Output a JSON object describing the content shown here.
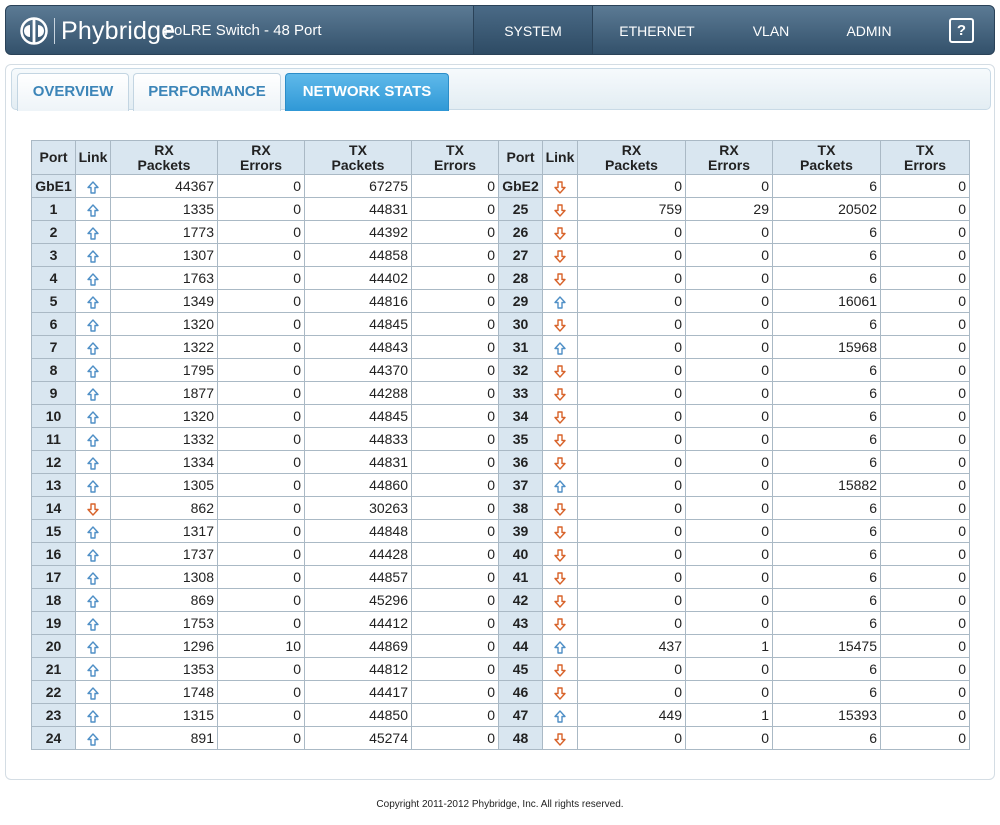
{
  "header": {
    "brand": "Phybridge",
    "product": "PoLRE Switch - 48 Port",
    "nav": [
      {
        "label": "SYSTEM",
        "active": true
      },
      {
        "label": "ETHERNET",
        "active": false
      },
      {
        "label": "VLAN",
        "active": false
      },
      {
        "label": "ADMIN",
        "active": false
      }
    ],
    "help_label": "?"
  },
  "tabs": [
    {
      "label": "OVERVIEW",
      "active": false
    },
    {
      "label": "PERFORMANCE",
      "active": false
    },
    {
      "label": "NETWORK STATS",
      "active": true
    }
  ],
  "colors": {
    "link_up": "#4f8fc6",
    "link_down": "#d8632a",
    "header_cell": "#d9e6f0",
    "active_tab": "#3aa3de"
  },
  "table": {
    "headers": [
      [
        "Port"
      ],
      [
        "Link"
      ],
      [
        "RX",
        "Packets"
      ],
      [
        "RX",
        "Errors"
      ],
      [
        "TX",
        "Packets"
      ],
      [
        "TX",
        "Errors"
      ],
      [
        "Port"
      ],
      [
        "Link"
      ],
      [
        "RX",
        "Packets"
      ],
      [
        "RX",
        "Errors"
      ],
      [
        "TX",
        "Packets"
      ],
      [
        "TX",
        "Errors"
      ]
    ],
    "rows": [
      {
        "left": {
          "port": "GbE1",
          "link": "up",
          "rx_packets": "44367",
          "rx_errors": "0",
          "tx_packets": "67275",
          "tx_errors": "0"
        },
        "right": {
          "port": "GbE2",
          "link": "down",
          "rx_packets": "0",
          "rx_errors": "0",
          "tx_packets": "6",
          "tx_errors": "0"
        }
      },
      {
        "left": {
          "port": "1",
          "link": "up",
          "rx_packets": "1335",
          "rx_errors": "0",
          "tx_packets": "44831",
          "tx_errors": "0"
        },
        "right": {
          "port": "25",
          "link": "down",
          "rx_packets": "759",
          "rx_errors": "29",
          "tx_packets": "20502",
          "tx_errors": "0"
        }
      },
      {
        "left": {
          "port": "2",
          "link": "up",
          "rx_packets": "1773",
          "rx_errors": "0",
          "tx_packets": "44392",
          "tx_errors": "0"
        },
        "right": {
          "port": "26",
          "link": "down",
          "rx_packets": "0",
          "rx_errors": "0",
          "tx_packets": "6",
          "tx_errors": "0"
        }
      },
      {
        "left": {
          "port": "3",
          "link": "up",
          "rx_packets": "1307",
          "rx_errors": "0",
          "tx_packets": "44858",
          "tx_errors": "0"
        },
        "right": {
          "port": "27",
          "link": "down",
          "rx_packets": "0",
          "rx_errors": "0",
          "tx_packets": "6",
          "tx_errors": "0"
        }
      },
      {
        "left": {
          "port": "4",
          "link": "up",
          "rx_packets": "1763",
          "rx_errors": "0",
          "tx_packets": "44402",
          "tx_errors": "0"
        },
        "right": {
          "port": "28",
          "link": "down",
          "rx_packets": "0",
          "rx_errors": "0",
          "tx_packets": "6",
          "tx_errors": "0"
        }
      },
      {
        "left": {
          "port": "5",
          "link": "up",
          "rx_packets": "1349",
          "rx_errors": "0",
          "tx_packets": "44816",
          "tx_errors": "0"
        },
        "right": {
          "port": "29",
          "link": "up",
          "rx_packets": "0",
          "rx_errors": "0",
          "tx_packets": "16061",
          "tx_errors": "0"
        }
      },
      {
        "left": {
          "port": "6",
          "link": "up",
          "rx_packets": "1320",
          "rx_errors": "0",
          "tx_packets": "44845",
          "tx_errors": "0"
        },
        "right": {
          "port": "30",
          "link": "down",
          "rx_packets": "0",
          "rx_errors": "0",
          "tx_packets": "6",
          "tx_errors": "0"
        }
      },
      {
        "left": {
          "port": "7",
          "link": "up",
          "rx_packets": "1322",
          "rx_errors": "0",
          "tx_packets": "44843",
          "tx_errors": "0"
        },
        "right": {
          "port": "31",
          "link": "up",
          "rx_packets": "0",
          "rx_errors": "0",
          "tx_packets": "15968",
          "tx_errors": "0"
        }
      },
      {
        "left": {
          "port": "8",
          "link": "up",
          "rx_packets": "1795",
          "rx_errors": "0",
          "tx_packets": "44370",
          "tx_errors": "0"
        },
        "right": {
          "port": "32",
          "link": "down",
          "rx_packets": "0",
          "rx_errors": "0",
          "tx_packets": "6",
          "tx_errors": "0"
        }
      },
      {
        "left": {
          "port": "9",
          "link": "up",
          "rx_packets": "1877",
          "rx_errors": "0",
          "tx_packets": "44288",
          "tx_errors": "0"
        },
        "right": {
          "port": "33",
          "link": "down",
          "rx_packets": "0",
          "rx_errors": "0",
          "tx_packets": "6",
          "tx_errors": "0"
        }
      },
      {
        "left": {
          "port": "10",
          "link": "up",
          "rx_packets": "1320",
          "rx_errors": "0",
          "tx_packets": "44845",
          "tx_errors": "0"
        },
        "right": {
          "port": "34",
          "link": "down",
          "rx_packets": "0",
          "rx_errors": "0",
          "tx_packets": "6",
          "tx_errors": "0"
        }
      },
      {
        "left": {
          "port": "11",
          "link": "up",
          "rx_packets": "1332",
          "rx_errors": "0",
          "tx_packets": "44833",
          "tx_errors": "0"
        },
        "right": {
          "port": "35",
          "link": "down",
          "rx_packets": "0",
          "rx_errors": "0",
          "tx_packets": "6",
          "tx_errors": "0"
        }
      },
      {
        "left": {
          "port": "12",
          "link": "up",
          "rx_packets": "1334",
          "rx_errors": "0",
          "tx_packets": "44831",
          "tx_errors": "0"
        },
        "right": {
          "port": "36",
          "link": "down",
          "rx_packets": "0",
          "rx_errors": "0",
          "tx_packets": "6",
          "tx_errors": "0"
        }
      },
      {
        "left": {
          "port": "13",
          "link": "up",
          "rx_packets": "1305",
          "rx_errors": "0",
          "tx_packets": "44860",
          "tx_errors": "0"
        },
        "right": {
          "port": "37",
          "link": "up",
          "rx_packets": "0",
          "rx_errors": "0",
          "tx_packets": "15882",
          "tx_errors": "0"
        }
      },
      {
        "left": {
          "port": "14",
          "link": "down",
          "rx_packets": "862",
          "rx_errors": "0",
          "tx_packets": "30263",
          "tx_errors": "0"
        },
        "right": {
          "port": "38",
          "link": "down",
          "rx_packets": "0",
          "rx_errors": "0",
          "tx_packets": "6",
          "tx_errors": "0"
        }
      },
      {
        "left": {
          "port": "15",
          "link": "up",
          "rx_packets": "1317",
          "rx_errors": "0",
          "tx_packets": "44848",
          "tx_errors": "0"
        },
        "right": {
          "port": "39",
          "link": "down",
          "rx_packets": "0",
          "rx_errors": "0",
          "tx_packets": "6",
          "tx_errors": "0"
        }
      },
      {
        "left": {
          "port": "16",
          "link": "up",
          "rx_packets": "1737",
          "rx_errors": "0",
          "tx_packets": "44428",
          "tx_errors": "0"
        },
        "right": {
          "port": "40",
          "link": "down",
          "rx_packets": "0",
          "rx_errors": "0",
          "tx_packets": "6",
          "tx_errors": "0"
        }
      },
      {
        "left": {
          "port": "17",
          "link": "up",
          "rx_packets": "1308",
          "rx_errors": "0",
          "tx_packets": "44857",
          "tx_errors": "0"
        },
        "right": {
          "port": "41",
          "link": "down",
          "rx_packets": "0",
          "rx_errors": "0",
          "tx_packets": "6",
          "tx_errors": "0"
        }
      },
      {
        "left": {
          "port": "18",
          "link": "up",
          "rx_packets": "869",
          "rx_errors": "0",
          "tx_packets": "45296",
          "tx_errors": "0"
        },
        "right": {
          "port": "42",
          "link": "down",
          "rx_packets": "0",
          "rx_errors": "0",
          "tx_packets": "6",
          "tx_errors": "0"
        }
      },
      {
        "left": {
          "port": "19",
          "link": "up",
          "rx_packets": "1753",
          "rx_errors": "0",
          "tx_packets": "44412",
          "tx_errors": "0"
        },
        "right": {
          "port": "43",
          "link": "down",
          "rx_packets": "0",
          "rx_errors": "0",
          "tx_packets": "6",
          "tx_errors": "0"
        }
      },
      {
        "left": {
          "port": "20",
          "link": "up",
          "rx_packets": "1296",
          "rx_errors": "10",
          "tx_packets": "44869",
          "tx_errors": "0"
        },
        "right": {
          "port": "44",
          "link": "up",
          "rx_packets": "437",
          "rx_errors": "1",
          "tx_packets": "15475",
          "tx_errors": "0"
        }
      },
      {
        "left": {
          "port": "21",
          "link": "up",
          "rx_packets": "1353",
          "rx_errors": "0",
          "tx_packets": "44812",
          "tx_errors": "0"
        },
        "right": {
          "port": "45",
          "link": "down",
          "rx_packets": "0",
          "rx_errors": "0",
          "tx_packets": "6",
          "tx_errors": "0"
        }
      },
      {
        "left": {
          "port": "22",
          "link": "up",
          "rx_packets": "1748",
          "rx_errors": "0",
          "tx_packets": "44417",
          "tx_errors": "0"
        },
        "right": {
          "port": "46",
          "link": "down",
          "rx_packets": "0",
          "rx_errors": "0",
          "tx_packets": "6",
          "tx_errors": "0"
        }
      },
      {
        "left": {
          "port": "23",
          "link": "up",
          "rx_packets": "1315",
          "rx_errors": "0",
          "tx_packets": "44850",
          "tx_errors": "0"
        },
        "right": {
          "port": "47",
          "link": "up",
          "rx_packets": "449",
          "rx_errors": "1",
          "tx_packets": "15393",
          "tx_errors": "0"
        }
      },
      {
        "left": {
          "port": "24",
          "link": "up",
          "rx_packets": "891",
          "rx_errors": "0",
          "tx_packets": "45274",
          "tx_errors": "0"
        },
        "right": {
          "port": "48",
          "link": "down",
          "rx_packets": "0",
          "rx_errors": "0",
          "tx_packets": "6",
          "tx_errors": "0"
        }
      }
    ]
  },
  "footer": "Copyright 2011-2012 Phybridge, Inc. All rights reserved."
}
